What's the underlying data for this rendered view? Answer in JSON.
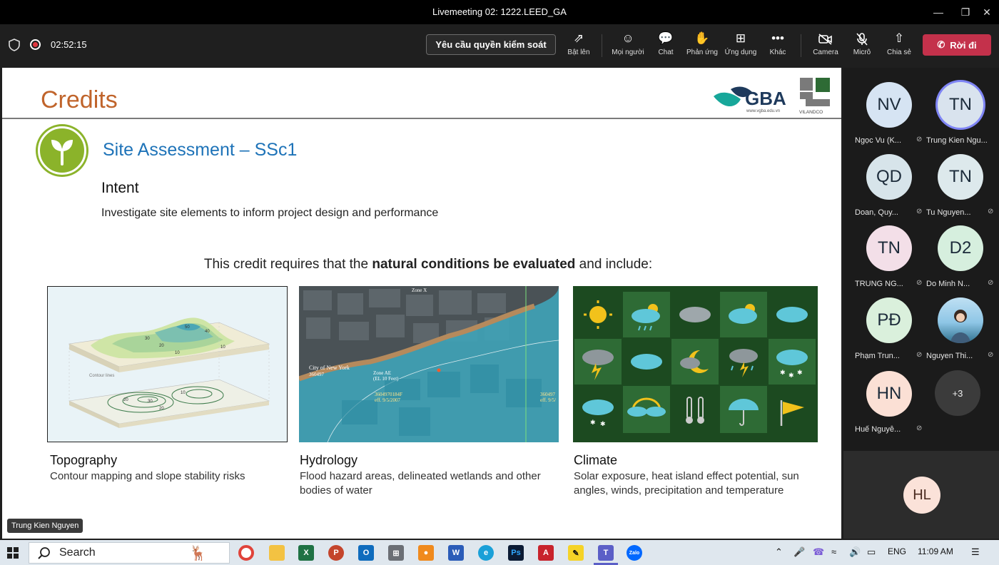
{
  "window": {
    "title": "Livemeeting 02: 1222.LEED_GA"
  },
  "toolbar": {
    "timer": "02:52:15",
    "request_control": "Yêu cầu quyền kiểm soát",
    "buttons": [
      {
        "label": "Bật lên",
        "icon": "pop-out-icon"
      },
      {
        "label": "Mọi người",
        "icon": "people-icon"
      },
      {
        "label": "Chat",
        "icon": "chat-icon"
      },
      {
        "label": "Phản ứng",
        "icon": "raise-hand-icon"
      },
      {
        "label": "Ứng dụng",
        "icon": "apps-icon"
      },
      {
        "label": "Khác",
        "icon": "more-icon"
      },
      {
        "label": "Camera",
        "icon": "camera-off-icon"
      },
      {
        "label": "Micrô",
        "icon": "mic-off-icon"
      },
      {
        "label": "Chia sẻ",
        "icon": "share-icon"
      }
    ],
    "leave": "Rời đi"
  },
  "slide": {
    "title": "Credits",
    "logo_text": "GBA",
    "logo_subtext": "www.vgba.edu.vn",
    "vilandco": "VILANDCO",
    "section_title": "Site Assessment – SSc1",
    "intent_heading": "Intent",
    "intent_text": "Investigate site elements to inform project design and performance",
    "requires_pre": "This credit requires that the ",
    "requires_bold": "natural conditions be evaluated",
    "requires_post": " and include:",
    "columns": [
      {
        "heading": "Topography",
        "text": "Contour mapping and slope stability risks"
      },
      {
        "heading": "Hydrology",
        "text": "Flood hazard areas, delineated wetlands and other bodies of water"
      },
      {
        "heading": "Climate",
        "text": "Solar exposure, heat island effect potential, sun angles, winds, precipitation and temperature"
      }
    ],
    "topo_labels": [
      "50",
      "40",
      "30",
      "20",
      "10",
      "10",
      "20",
      "30",
      "20",
      "10"
    ],
    "topo_caption": "Contour lines",
    "hydro_labels": [
      "Zone X",
      "City of New York",
      "360497",
      "Zone AE",
      "(EL 10 Feet)",
      "3604970184F",
      "eff. 9/5/2007",
      "360497",
      "eff. 9/5/"
    ]
  },
  "presenter_tag": "Trung Kien Nguyen",
  "participants": [
    {
      "initials": "NV",
      "name": "Ngọc Vu (K...",
      "color": "#d6e4f3"
    },
    {
      "initials": "TN",
      "name": "Trung Kien Ngu...",
      "color": "#d9e3ee"
    },
    {
      "initials": "QD",
      "name": "Doan, Quy...",
      "color": "#d7e4ea"
    },
    {
      "initials": "TN",
      "name": "Tu Nguyen...",
      "color": "#dde9ec"
    },
    {
      "initials": "TN",
      "name": "TRUNG NG...",
      "color": "#f3dfe8"
    },
    {
      "initials": "D2",
      "name": "Do Minh N...",
      "color": "#d6efde"
    },
    {
      "initials": "PĐ",
      "name": "Phạm Trun...",
      "color": "#daf0dc"
    },
    {
      "initials": "",
      "name": "Nguyen Thi...",
      "color": "#9ec9e6"
    },
    {
      "initials": "HN",
      "name": "Huế Nguyễ...",
      "color": "#fbe0d5"
    }
  ],
  "more_count": "+3",
  "self_initials": "HL",
  "taskbar": {
    "search": "Search",
    "lang": "ENG",
    "time": "11:09 AM"
  }
}
